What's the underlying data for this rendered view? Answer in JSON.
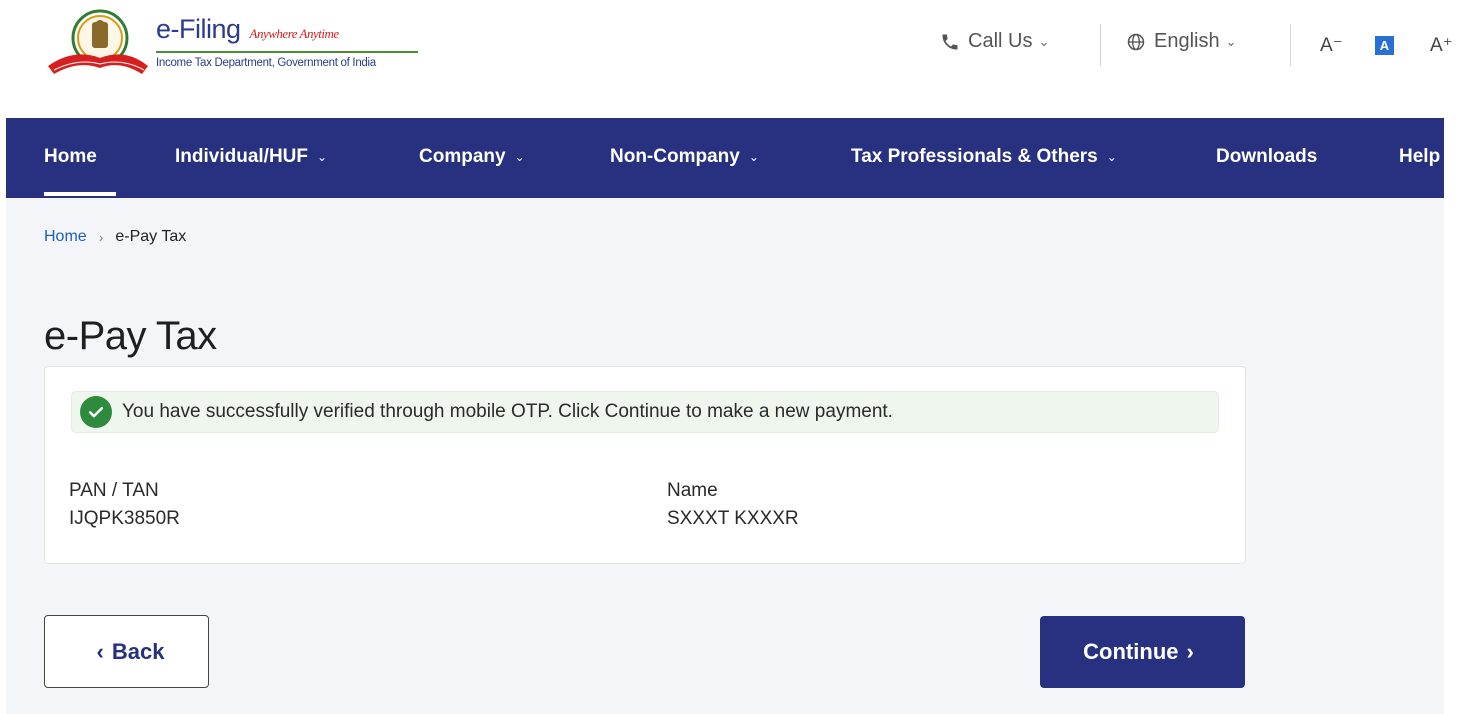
{
  "header": {
    "brand_title": "e-Filing",
    "brand_tagline": "Anywhere Anytime",
    "brand_subtitle": "Income Tax Department, Government of India",
    "call_us_label": "Call Us",
    "language_label": "English",
    "font_decrease": "A⁻",
    "font_default": "A",
    "font_increase": "A⁺"
  },
  "nav": {
    "items": [
      {
        "label": "Home"
      },
      {
        "label": "Individual/HUF"
      },
      {
        "label": "Company"
      },
      {
        "label": "Non-Company"
      },
      {
        "label": "Tax Professionals & Others"
      },
      {
        "label": "Downloads"
      },
      {
        "label": "Help"
      }
    ]
  },
  "breadcrumb": {
    "home": "Home",
    "current": "e-Pay Tax"
  },
  "page": {
    "title": "e-Pay Tax",
    "alert_message": "You have successfully verified through mobile OTP. Click Continue to make a new payment.",
    "pan_label": "PAN / TAN",
    "pan_value": "IJQPK3850R",
    "name_label": "Name",
    "name_value": "SXXXT KXXXR"
  },
  "actions": {
    "back_label": "Back",
    "continue_label": "Continue"
  },
  "colors": {
    "primary": "#28317f",
    "success": "#2e8a3c",
    "link": "#1f5fbf"
  }
}
